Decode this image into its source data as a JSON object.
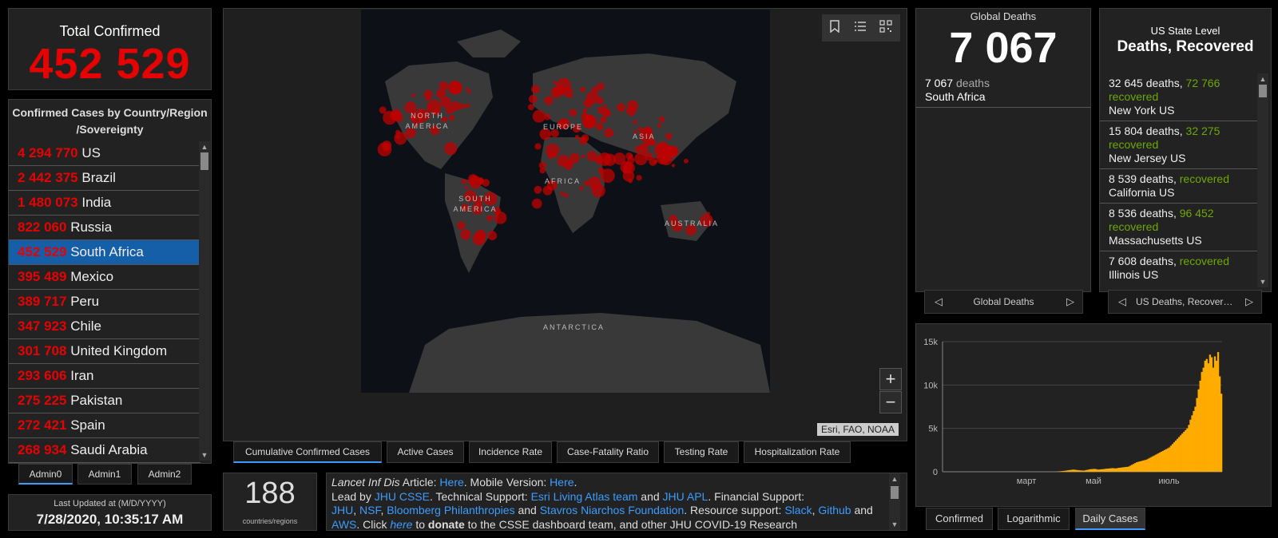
{
  "total": {
    "title": "Total Confirmed",
    "value": "452 529"
  },
  "countries": {
    "header_line1": "Confirmed Cases by Country/Region",
    "header_line2": "/Sovereignty",
    "rows": [
      {
        "num": "4 294 770",
        "name": "US"
      },
      {
        "num": "2 442 375",
        "name": "Brazil"
      },
      {
        "num": "1 480 073",
        "name": "India"
      },
      {
        "num": "822 060",
        "name": "Russia"
      },
      {
        "num": "452 529",
        "name": "South Africa",
        "selected": true
      },
      {
        "num": "395 489",
        "name": "Mexico"
      },
      {
        "num": "389 717",
        "name": "Peru"
      },
      {
        "num": "347 923",
        "name": "Chile"
      },
      {
        "num": "301 708",
        "name": "United Kingdom"
      },
      {
        "num": "293 606",
        "name": "Iran"
      },
      {
        "num": "275 225",
        "name": "Pakistan"
      },
      {
        "num": "272 421",
        "name": "Spain"
      },
      {
        "num": "268 934",
        "name": "Saudi Arabia"
      }
    ]
  },
  "admin_tabs": [
    "Admin0",
    "Admin1",
    "Admin2"
  ],
  "updated": {
    "label": "Last Updated at (M/D/YYYY)",
    "value": "7/28/2020, 10:35:17 AM"
  },
  "map": {
    "labels": {
      "north_america": "NORTH AMERICA",
      "south_america": "SOUTH AMERICA",
      "europe": "EUROPE",
      "asia": "ASIA",
      "africa": "AFRICA",
      "australia": "AUSTRALIA",
      "antarctica": "ANTARCTICA"
    },
    "attribution": "Esri, FAO, NOAA",
    "zoom_in": "+",
    "zoom_out": "−",
    "tools": [
      "bookmark-icon",
      "legend-list-icon",
      "qr-code-icon"
    ],
    "tabs": [
      "Cumulative Confirmed Cases",
      "Active Cases",
      "Incidence Rate",
      "Case-Fatality Ratio",
      "Testing Rate",
      "Hospitalization Rate"
    ]
  },
  "countries_count": {
    "value": "188",
    "label": "countries/regions"
  },
  "info": {
    "journal": "Lancet Inf Dis",
    "article": "Article:",
    "here1": "Here",
    "mobile": ". Mobile Version:",
    "here2": "Here",
    "lead": "Lead by",
    "jhu_csse": "JHU CSSE",
    "tech": ". Technical Support:",
    "esri": "Esri Living Atlas team",
    "and1": "and",
    "jhu_apl": "JHU APL",
    "fin": ". Financial Support:",
    "jhu": "JHU",
    "nsf": "NSF",
    "bloomberg": "Bloomberg Philanthropies",
    "and2": "and",
    "stavros": "Stavros Niarchos Foundation",
    "res": ". Resource support:",
    "slack": "Slack",
    "github": "Github",
    "and3": "and",
    "aws": "AWS",
    "click": ". Click",
    "here3": "here",
    "to": "to",
    "donate": "donate",
    "rest": "to the CSSE dashboard team, and other JHU COVID-19 Research"
  },
  "global_deaths": {
    "title": "Global Deaths",
    "value": "7 067",
    "entry_num": "7 067",
    "entry_unit": "deaths",
    "entry_place": "South Africa",
    "pager_label": "Global Deaths"
  },
  "us_state": {
    "title1": "US State Level",
    "title2": "Deaths, Recovered",
    "rows": [
      {
        "deaths": "32 645 deaths,",
        "rec": "72 766",
        "rec_label": "recovered",
        "place": "New York US"
      },
      {
        "deaths": "15 804 deaths,",
        "rec": "32 275",
        "rec_label": "recovered",
        "place": "New Jersey US"
      },
      {
        "deaths": "8 539 deaths,",
        "rec": "",
        "rec_label": "recovered",
        "place": "California US"
      },
      {
        "deaths": "8 536 deaths,",
        "rec": "96 452",
        "rec_label": "recovered",
        "place": "Massachusetts US"
      },
      {
        "deaths": "7 608 deaths,",
        "rec": "",
        "rec_label": "recovered",
        "place": "Illinois US"
      }
    ],
    "pager_label": "US Deaths, Recover…"
  },
  "chart_tabs": [
    "Confirmed",
    "Logarithmic",
    "Daily Cases"
  ],
  "colors": {
    "accent_red": "#e60000",
    "recovered_green": "#70a800",
    "link_blue": "#3b9cff",
    "bar_orange": "#ffab00",
    "selected_row": "#155ea8"
  },
  "chart_data": {
    "type": "bar",
    "title": "",
    "xlabel": "",
    "ylabel": "",
    "ylim": [
      0,
      15000
    ],
    "yticks": [
      "0",
      "5k",
      "10k",
      "15k"
    ],
    "xticks": [
      "март",
      "май",
      "июль"
    ],
    "color": "#ffab00",
    "values": [
      0,
      0,
      0,
      0,
      0,
      0,
      0,
      0,
      0,
      0,
      0,
      0,
      0,
      0,
      0,
      0,
      0,
      0,
      0,
      0,
      0,
      0,
      0,
      0,
      0,
      0,
      0,
      0,
      0,
      0,
      0,
      0,
      0,
      0,
      0,
      0,
      0,
      0,
      0,
      0,
      0,
      0,
      0,
      0,
      0,
      0,
      0,
      0,
      0,
      0,
      0,
      0,
      0,
      0,
      0,
      0,
      0,
      0,
      0,
      0,
      0,
      0,
      0,
      0,
      0,
      0,
      0,
      0,
      0,
      0,
      20,
      40,
      60,
      80,
      100,
      120,
      150,
      180,
      200,
      230,
      250,
      230,
      200,
      180,
      160,
      150,
      140,
      150,
      200,
      230,
      280,
      300,
      320,
      330,
      300,
      250,
      260,
      280,
      300,
      320,
      350,
      360,
      380,
      400,
      420,
      400,
      380,
      420,
      450,
      470,
      500,
      520,
      540,
      560,
      600,
      700,
      800,
      900,
      1000,
      1100,
      1150,
      1200,
      1250,
      1300,
      1350,
      1400,
      1500,
      1600,
      1700,
      1800,
      1900,
      2000,
      2100,
      2200,
      2300,
      2400,
      2500,
      2600,
      2700,
      2800,
      3000,
      3200,
      3400,
      3600,
      3800,
      4000,
      4200,
      4400,
      4600,
      4800,
      5000,
      5400,
      6000,
      6500,
      7000,
      7500,
      8500,
      9500,
      10500,
      11500,
      12000,
      12800,
      13000,
      12500,
      13500,
      13200,
      12000,
      13300,
      12800,
      13800,
      11000,
      9000
    ]
  }
}
